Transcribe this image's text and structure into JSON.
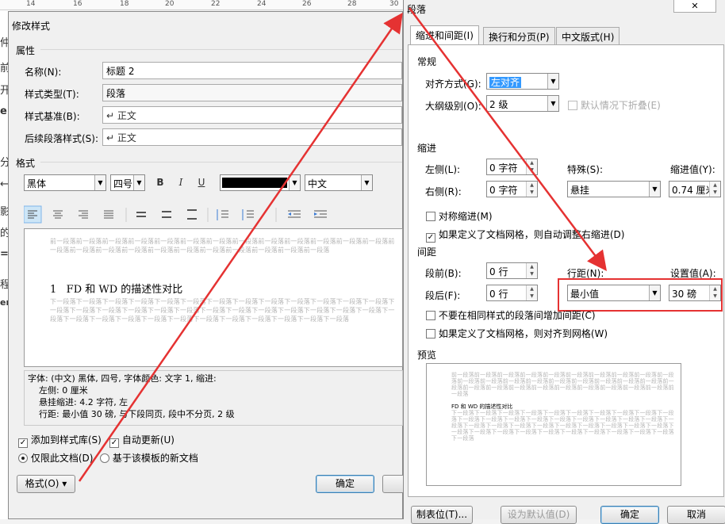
{
  "ruler": {
    "labels": [
      "14",
      "16",
      "18",
      "20",
      "22",
      "24",
      "26",
      "28",
      "30"
    ]
  },
  "doc_left_chars": [
    "仲",
    "前",
    "开",
    "e",
    "分",
    "←",
    "影",
    "的",
    "=",
    "程",
    "er"
  ],
  "modify_style": {
    "title": "修改样式",
    "properties_label": "属性",
    "name_label": "名称(N):",
    "name_value": "标题 2",
    "type_label": "样式类型(T):",
    "type_value": "段落",
    "based_label": "样式基准(B):",
    "based_value": "↵ 正文",
    "next_label": "后续段落样式(S):",
    "next_value": "↵ 正文",
    "format_label": "格式",
    "font_value": "黑体",
    "size_value": "四号",
    "bold": "B",
    "italic": "I",
    "underline": "U",
    "lang_value": "中文",
    "preview_prev": "前一段落前一段落前一段落前一段落前一段落前一段落前一段落前一段落前一段落前一段落前一段落前一段落前一段落前一段落前一段落前一段落前一段落前一段落前一段落前一段落前一段落前一段落前一段落前一段落",
    "preview_heading": "1   FD 和 WD 的描述性对比",
    "preview_next": "下一段落下一段落下一段落下一段落下一段落下一段落下一段落下一段落下一段落下一段落下一段落下一段落下一段落下一段落下一段落下一段落下一段落下一段落下一段落下一段落下一段落下一段落下一段落下一段落下一段落下一段落下一段落下一段落下一段落下一段落下一段落下一段落下一段落下一段落下一段落下一段落下一段落下一段落",
    "desc_line1": "字体: (中文) 黑体, 四号, 字体颜色: 文字 1, 缩进:",
    "desc_line2": "左侧:  0 厘米",
    "desc_line3": "悬挂缩进: 4.2 字符, 左",
    "desc_line4": "行距: 最小值 30 磅, 与下段同页, 段中不分页, 2 级",
    "add_gallery": "添加到样式库(S)",
    "auto_update": "自动更新(U)",
    "only_doc": "仅限此文档(D)",
    "new_template": "基于该模板的新文档",
    "format_button": "格式(O) ▾",
    "ok": "确定"
  },
  "paragraph": {
    "title": "段落",
    "close": "✕",
    "tabs": [
      "缩进和间距(I)",
      "换行和分页(P)",
      "中文版式(H)"
    ],
    "general_label": "常规",
    "align_label": "对齐方式(G):",
    "align_value": "左对齐",
    "outline_label": "大纲级别(O):",
    "outline_value": "2 级",
    "collapse_label": "默认情况下折叠(E)",
    "indent_label": "缩进",
    "left_label": "左侧(L):",
    "left_value": "0 字符",
    "right_label": "右侧(R):",
    "right_value": "0 字符",
    "special_label": "特殊(S):",
    "special_value": "悬挂",
    "indent_by_label": "缩进值(Y):",
    "indent_by_value": "0.74 厘米",
    "mirror_label": "对称缩进(M)",
    "auto_adjust_label": "如果定义了文档网格，则自动调整右缩进(D)",
    "spacing_label": "间距",
    "before_label": "段前(B):",
    "before_value": "0 行",
    "after_label": "段后(F):",
    "after_value": "0 行",
    "line_spacing_label": "行距(N):",
    "line_spacing_value": "最小值",
    "at_label": "设置值(A):",
    "at_value": "30 磅",
    "no_space_label": "不要在相同样式的段落间增加间距(C)",
    "snap_grid_label": "如果定义了文档网格，则对齐到网格(W)",
    "preview_label": "预览",
    "preview_prev": "前一段落前一段落前一段落前一段落前一段落前一段落前一段落前一段落前一段落前一段落前一段落前一段落前一段落前一段落前一段落前一段落前一段落前一段落前一段落前一段落前一段落前一段落前一段落前一段落前一段落前一段落前一段落前一段落前一段落前一段落",
    "preview_heading": "FD 和 WD 的描述性对比",
    "preview_next": "下一段落下一段落下一段落下一段落下一段落下一段落下一段落下一段落下一段落下一段落下一段落下一段落下一段落下一段落下一段落下一段落下一段落下一段落下一段落下一段落下一段落下一段落下一段落下一段落下一段落下一段落下一段落下一段落下一段落下一段落下一段落下一段落下一段落下一段落下一段落下一段落下一段落下一段落下一段落下一段落",
    "tabs_button": "制表位(T)...",
    "default_button": "设为默认值(D)",
    "ok": "确定",
    "cancel": "取消"
  },
  "colors": {
    "annotation_red": "#e53232",
    "selection": "#3399ff",
    "font_color": "#000000"
  }
}
